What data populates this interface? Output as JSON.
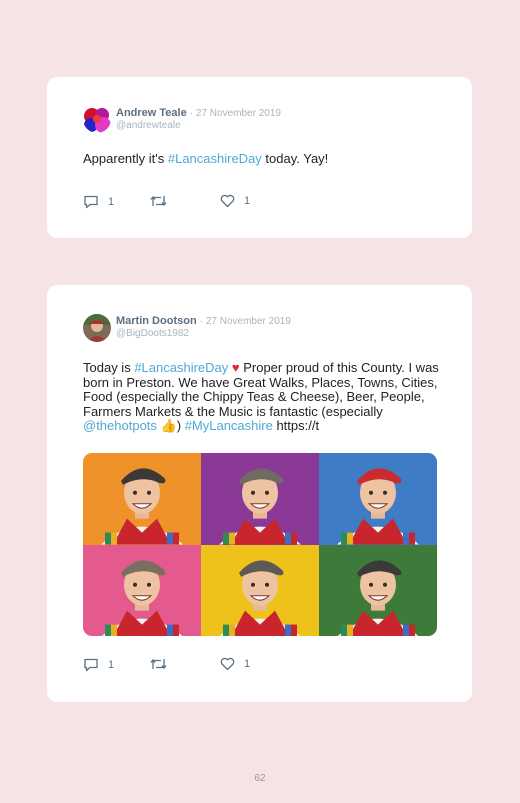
{
  "tweets": [
    {
      "name": "Andrew Teale",
      "date": "· 27 November 2019",
      "handle": "@andrewteale",
      "text_before": "Apparently it's ",
      "hashtag": "#LancashireDay",
      "text_after": " today. Yay!",
      "replies": "1",
      "likes": "1"
    },
    {
      "name": "Martin Dootson",
      "date": "· 27 November 2019",
      "handle": "@BigDoots1982",
      "t1": "Today is ",
      "hashtag1": "#LancashireDay",
      "heart": "♥",
      "t2": " Proper proud of this County. I was born in Preston. We have Great Walks, Places, Towns, Cities, Food (especially the Chippy Teas & Cheese), Beer, People, Farmers Markets & the Music is fantastic (especially ",
      "mention": "@thehotpots",
      "thumb": "👍",
      "t3": ") ",
      "hashtag2": "#MyLancashire",
      "t4": " https://t",
      "replies": "1",
      "likes": "1",
      "photo_backgrounds": [
        "#f0922a",
        "#8a3a96",
        "#3f7cc6",
        "#e45a8e",
        "#efc11b",
        "#3e7b3a"
      ],
      "photo_caps": [
        "#3c3a38",
        "#6f6a62",
        "#c92b2e",
        "#7a6e60",
        "#5d5a55",
        "#3b3a38"
      ]
    }
  ],
  "page_number": "62",
  "colors": {
    "link": "#4fa9d8",
    "name": "#5b6f83",
    "meta": "#a9b4be",
    "background": "#f6e3e5"
  }
}
